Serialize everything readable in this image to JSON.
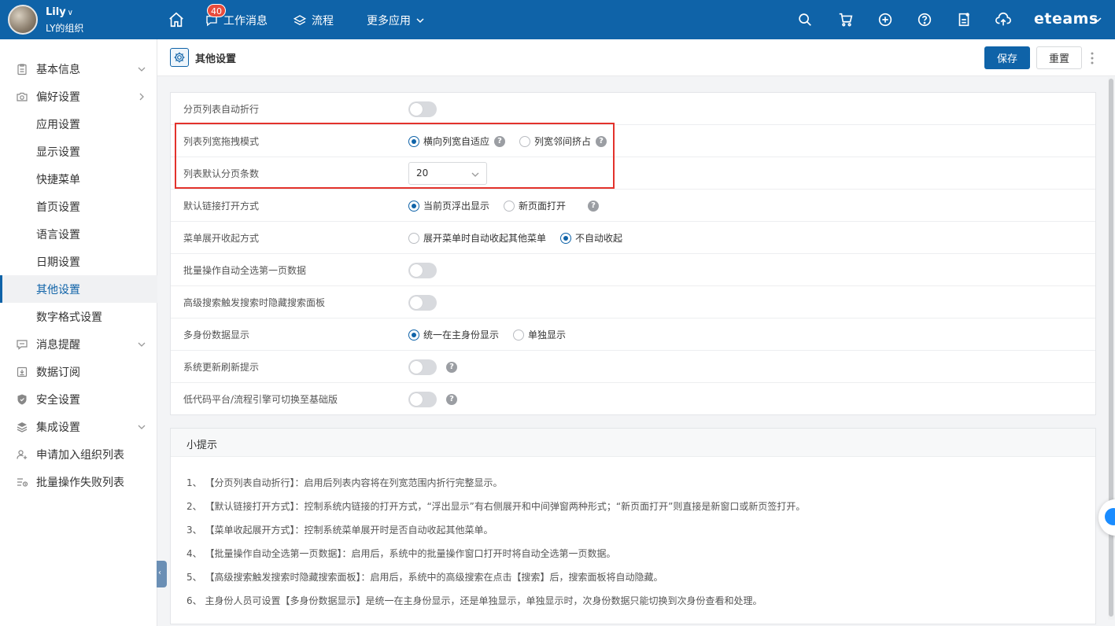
{
  "user": {
    "name": "Lily",
    "org": "LY的组织"
  },
  "nav": {
    "messages": "工作消息",
    "messages_badge": "40",
    "flow": "流程",
    "more": "更多应用"
  },
  "brand": "eteams",
  "sidebar": {
    "items": [
      {
        "label": "基本信息"
      },
      {
        "label": "偏好设置"
      },
      {
        "label": "应用设置"
      },
      {
        "label": "显示设置"
      },
      {
        "label": "快捷菜单"
      },
      {
        "label": "首页设置"
      },
      {
        "label": "语言设置"
      },
      {
        "label": "日期设置"
      },
      {
        "label": "其他设置"
      },
      {
        "label": "数字格式设置"
      },
      {
        "label": "消息提醒"
      },
      {
        "label": "数据订阅"
      },
      {
        "label": "安全设置"
      },
      {
        "label": "集成设置"
      },
      {
        "label": "申请加入组织列表"
      },
      {
        "label": "批量操作失败列表"
      }
    ]
  },
  "header": {
    "title": "其他设置",
    "save": "保存",
    "reset": "重置"
  },
  "settings": {
    "row0": {
      "label": "分页列表自动折行"
    },
    "row1": {
      "label": "列表列宽拖拽模式",
      "opt1": "横向列宽自适应",
      "opt2": "列宽邻间挤占"
    },
    "row2": {
      "label": "列表默认分页条数",
      "value": "20"
    },
    "row3": {
      "label": "默认链接打开方式",
      "opt1": "当前页浮出显示",
      "opt2": "新页面打开"
    },
    "row4": {
      "label": "菜单展开收起方式",
      "opt1": "展开菜单时自动收起其他菜单",
      "opt2": "不自动收起"
    },
    "row5": {
      "label": "批量操作自动全选第一页数据"
    },
    "row6": {
      "label": "高级搜索触发搜索时隐藏搜索面板"
    },
    "row7": {
      "label": "多身份数据显示",
      "opt1": "统一在主身份显示",
      "opt2": "单独显示"
    },
    "row8": {
      "label": "系统更新刷新提示"
    },
    "row9": {
      "label": "低代码平台/流程引擎可切换至基础版"
    },
    "help_glyph": "?"
  },
  "tips": {
    "title": "小提示",
    "items": [
      "1、 【分页列表自动折行】：启用后列表内容将在列宽范围内折行完整显示。",
      "2、 【默认链接打开方式】：控制系统内链接的打开方式，“浮出显示”有右侧展开和中间弹窗两种形式；“新页面打开”则直接是新窗口或新页签打开。",
      "3、 【菜单收起展开方式】：控制系统菜单展开时是否自动收起其他菜单。",
      "4、 【批量操作自动全选第一页数据】：启用后，系统中的批量操作窗口打开时将自动全选第一页数据。",
      "5、 【高级搜索触发搜索时隐藏搜索面板】：启用后，系统中的高级搜索在点击【搜索】后，搜索面板将自动隐藏。",
      "6、 主身份人员可设置【多身份数据显示】是统一在主身份显示，还是单独显示，单独显示时，次身份数据只能切换到次身份查看和处理。"
    ]
  },
  "colors": {
    "primary": "#0f63a8",
    "highlight": "#e3322c",
    "badge": "#e84b3c"
  }
}
